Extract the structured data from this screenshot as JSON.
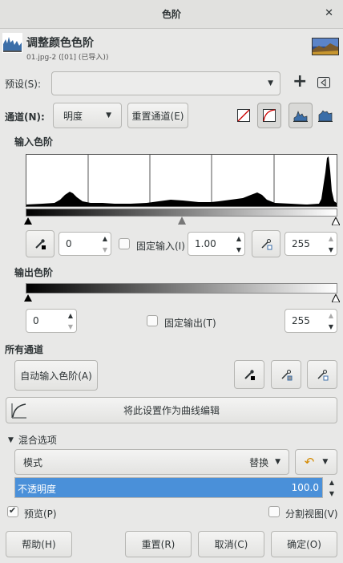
{
  "window": {
    "title": "色阶",
    "close_glyph": "✕"
  },
  "header": {
    "title": "调整颜色色阶",
    "subtitle": "01.jpg-2 ([01] (已导入))"
  },
  "presets": {
    "label": "预设(S):",
    "value": "",
    "add_glyph": "+",
    "menu_icon": "tab-menu-icon"
  },
  "channel": {
    "label": "通道(N):",
    "value": "明度",
    "reset_label": "重置通道(E)"
  },
  "input_levels": {
    "label": "输入色阶",
    "low": "0",
    "gamma": "1.00",
    "high": "255",
    "fixed_label": "固定输入(I)",
    "fixed_checked": false
  },
  "output_levels": {
    "label": "输出色阶",
    "low": "0",
    "high": "255",
    "fixed_label": "固定输出(T)",
    "fixed_checked": false
  },
  "all_channels": {
    "label": "所有通道",
    "auto_label": "自动输入色阶(A)"
  },
  "curves_button": {
    "label": "将此设置作为曲线编辑"
  },
  "blend": {
    "label": "混合选项",
    "mode_label": "模式",
    "mode_value": "替换",
    "opacity_label": "不透明度",
    "opacity_value": "100.0",
    "opacity_fraction": 1.0
  },
  "preview": {
    "label": "预览(P)",
    "checked": true,
    "split_label": "分割视图(V)",
    "split_checked": false
  },
  "footer": {
    "help": "帮助(H)",
    "reset": "重置(R)",
    "cancel": "取消(C)",
    "ok": "确定(O)"
  },
  "colors": {
    "accent": "#4a90d9",
    "histogram": "#000000"
  }
}
